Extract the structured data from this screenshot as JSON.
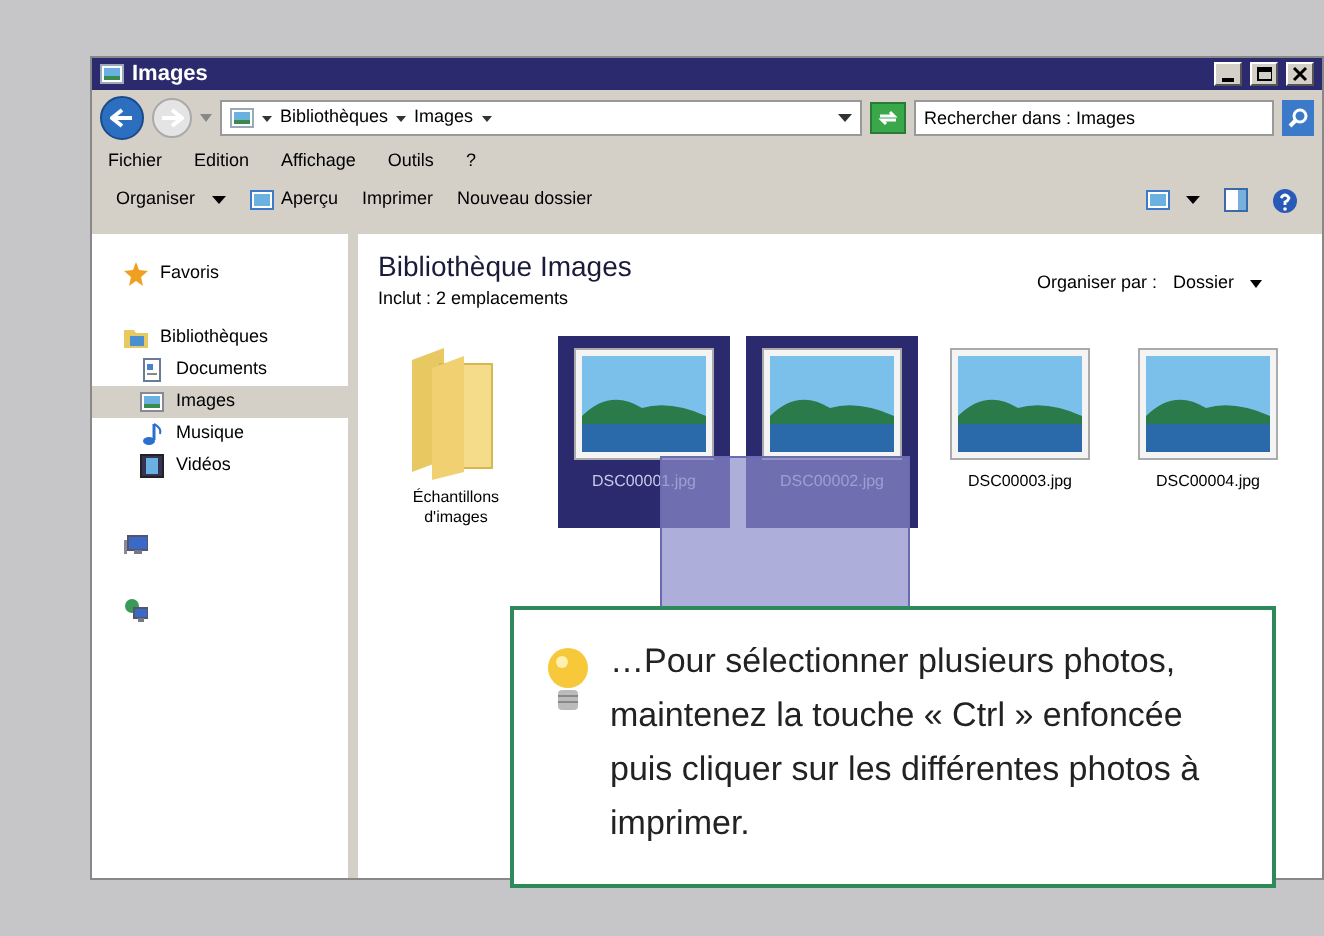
{
  "window": {
    "title": "Images"
  },
  "address": {
    "crumbs": [
      "Bibliothèques",
      "Images"
    ]
  },
  "search": {
    "placeholder": "Rechercher dans : Images"
  },
  "menu": [
    "Fichier",
    "Edition",
    "Affichage",
    "Outils",
    "?"
  ],
  "toolbar": [
    {
      "label": "Organiser",
      "kind": "dropdown"
    },
    {
      "label": "Aperçu",
      "kind": "icon"
    },
    {
      "label": "Imprimer",
      "kind": "plain"
    },
    {
      "label": "Nouveau dossier",
      "kind": "plain"
    }
  ],
  "sidebar": {
    "items": [
      {
        "label": "Favoris",
        "kind": "star",
        "selected": false
      },
      {
        "label": "Bibliothèques",
        "kind": "library",
        "selected": false,
        "children": [
          {
            "label": "Documents",
            "kind": "document",
            "selected": false
          },
          {
            "label": "Images",
            "kind": "picture",
            "selected": true
          },
          {
            "label": "Musique",
            "kind": "music",
            "selected": false
          },
          {
            "label": "Vidéos",
            "kind": "video",
            "selected": false
          }
        ]
      },
      {
        "kind": "computer",
        "selected": false
      },
      {
        "kind": "network",
        "selected": false
      }
    ]
  },
  "library": {
    "title": "Bibliothèque Images",
    "subtitle": "Inclut : 2 emplacements",
    "arrange_label": "Organiser par :",
    "arrange_value": "Dossier"
  },
  "files": [
    {
      "name": "Échantillons d'images",
      "kind": "folder",
      "selected": false
    },
    {
      "name": "DSC00001.jpg",
      "kind": "photo",
      "selected": true
    },
    {
      "name": "DSC00002.jpg",
      "kind": "photo",
      "selected": true
    },
    {
      "name": "DSC00003.jpg",
      "kind": "photo",
      "selected": false
    },
    {
      "name": "DSC00004.jpg",
      "kind": "photo",
      "selected": false
    }
  ],
  "tip": {
    "text": "…Pour sélectionner plusieurs photos, maintenez la touche « Ctrl » enfoncée puis cliquer sur les différentes photos à imprimer."
  }
}
